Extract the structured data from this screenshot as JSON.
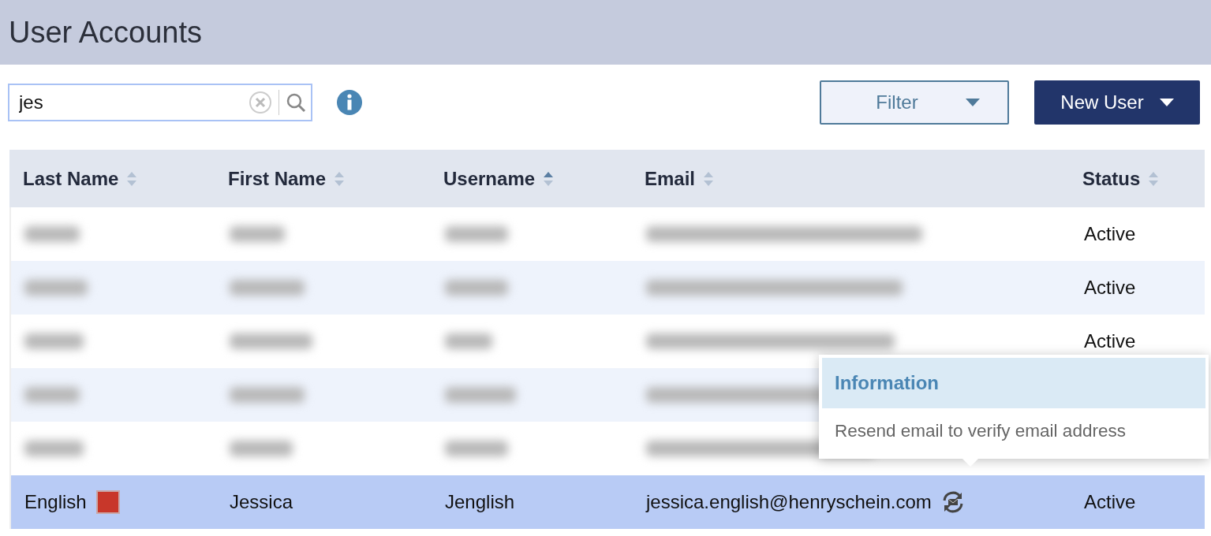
{
  "page": {
    "title": "User Accounts"
  },
  "search": {
    "value": "jes",
    "focused": true
  },
  "filter_button": {
    "label": "Filter"
  },
  "new_user_button": {
    "label": "New User"
  },
  "table": {
    "columns": [
      {
        "label": "Last Name",
        "sorted": false
      },
      {
        "label": "First Name",
        "sorted": false
      },
      {
        "label": "Username",
        "sorted": true
      },
      {
        "label": "Email",
        "sorted": false
      },
      {
        "label": "Status",
        "sorted": false
      }
    ],
    "rows": [
      {
        "redacted": true,
        "status": "Active",
        "selected": false,
        "flagged": false
      },
      {
        "redacted": true,
        "status": "Active",
        "selected": false,
        "flagged": false
      },
      {
        "redacted": true,
        "status": "Active",
        "selected": false,
        "flagged": false
      },
      {
        "redacted": true,
        "selected": false,
        "flagged": false
      },
      {
        "redacted": true,
        "selected": false,
        "flagged": false
      },
      {
        "redacted": false,
        "last_name": "English",
        "first_name": "Jessica",
        "username": "Jenglish",
        "email": "jessica.english@henryschein.com",
        "status": "Active",
        "selected": true,
        "flagged": true,
        "resend_icon": true
      }
    ]
  },
  "tooltip": {
    "title": "Information",
    "text": "Resend email to verify email address"
  }
}
